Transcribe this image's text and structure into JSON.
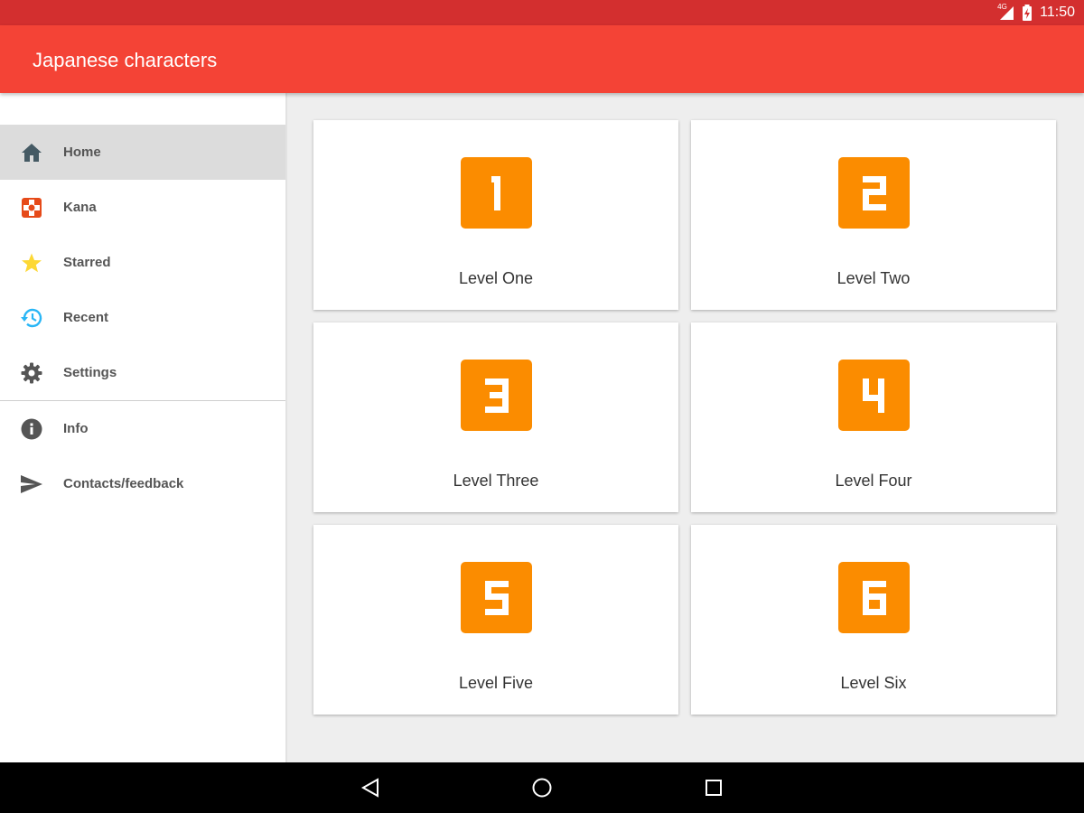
{
  "status_bar": {
    "time": "11:50",
    "network": "4G",
    "icons": [
      "signal-icon",
      "battery-charging-icon"
    ]
  },
  "app_bar": {
    "title": "Japanese characters",
    "color": "#f44336"
  },
  "drawer": {
    "items": [
      {
        "label": "Home",
        "icon": "home-icon",
        "active": true
      },
      {
        "label": "Kana",
        "icon": "kana-icon",
        "active": false
      },
      {
        "label": "Starred",
        "icon": "star-icon",
        "active": false
      },
      {
        "label": "Recent",
        "icon": "history-icon",
        "active": false
      },
      {
        "label": "Settings",
        "icon": "gear-icon",
        "active": false
      },
      {
        "label": "Info",
        "icon": "info-icon",
        "active": false
      },
      {
        "label": "Contacts/feedback",
        "icon": "send-icon",
        "active": false
      }
    ]
  },
  "levels": [
    {
      "number": "1",
      "label": "Level One"
    },
    {
      "number": "2",
      "label": "Level Two"
    },
    {
      "number": "3",
      "label": "Level Three"
    },
    {
      "number": "4",
      "label": "Level Four"
    },
    {
      "number": "5",
      "label": "Level Five"
    },
    {
      "number": "6",
      "label": "Level Six"
    }
  ],
  "nav_bar": {
    "buttons": [
      "back-icon",
      "home-circle-icon",
      "recents-icon"
    ]
  },
  "colors": {
    "status_bar": "#d32f2f",
    "accent": "#fb8c00",
    "active_item": "#dcdcdc"
  }
}
